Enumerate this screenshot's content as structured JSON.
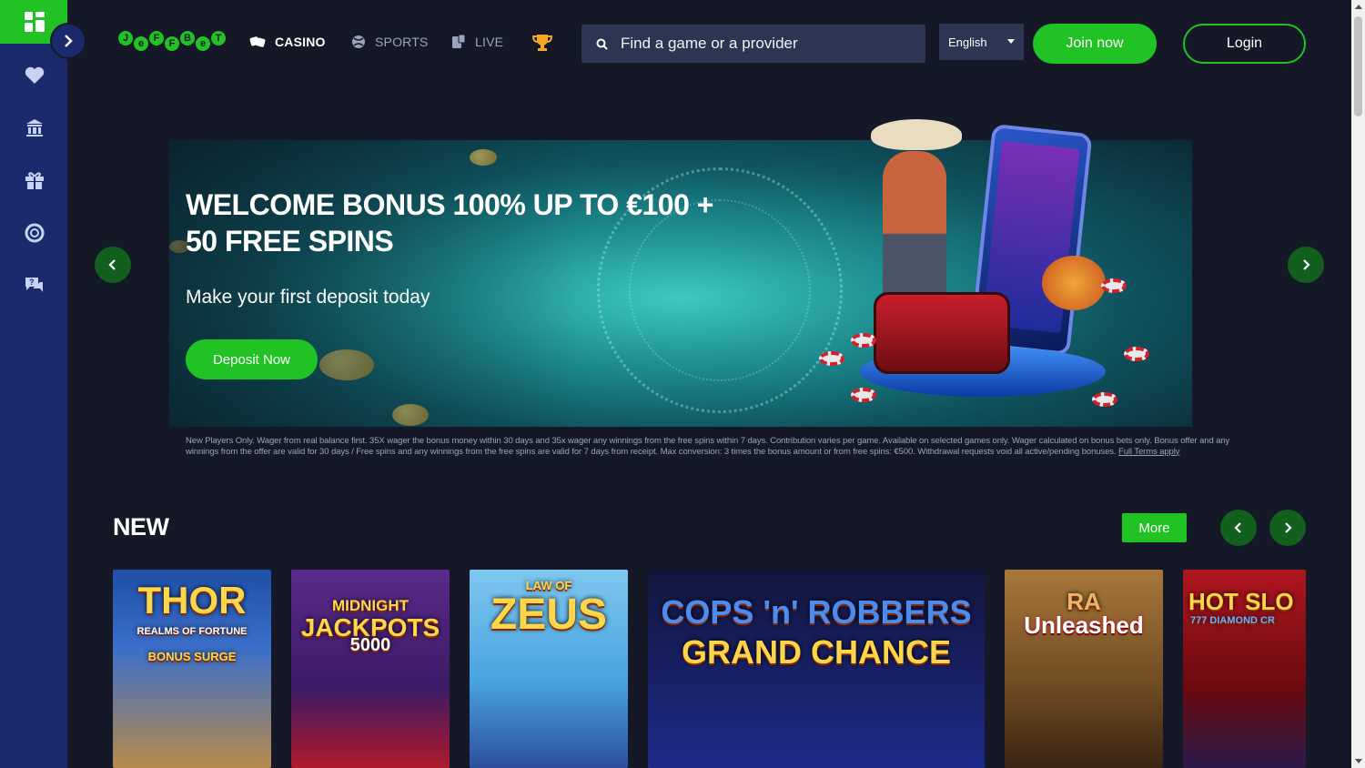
{
  "brand": {
    "logo_letters": [
      "J",
      "e",
      "F",
      "F",
      "B",
      "e",
      "T"
    ]
  },
  "sidebar": {
    "items": [
      {
        "icon": "heart-icon"
      },
      {
        "icon": "casino-building-icon"
      },
      {
        "icon": "gift-icon"
      },
      {
        "icon": "lifebuoy-icon"
      },
      {
        "icon": "help-chat-icon"
      }
    ]
  },
  "nav": {
    "items": [
      {
        "label": "CASINO",
        "icon": "dice-icon",
        "active": true
      },
      {
        "label": "SPORTS",
        "icon": "ball-icon",
        "active": false
      },
      {
        "label": "LIVE",
        "icon": "live-cards-icon",
        "active": false
      }
    ],
    "trophy_icon": "trophy-icon"
  },
  "search": {
    "placeholder": "Find a game or a provider"
  },
  "language": {
    "selected": "English"
  },
  "auth": {
    "join_label": "Join now",
    "login_label": "Login"
  },
  "banner": {
    "title_line1": "WELCOME BONUS 100% UP TO €100 +",
    "title_line2": "50 FREE SPINS",
    "subtitle": "Make your first deposit today",
    "cta_label": "Deposit Now",
    "terms_text": "New Players Only. Wager from real balance first. 35X wager the bonus money within 30 days and 35x wager any winnings from the free spins within 7 days. Contribution varies per game. Available on selected games only. Wager calculated on bonus bets only. Bonus offer and any winnings from the offer are valid for 30 days / Free spins and any winnings from the free spins are valid for 7 days from receipt. Max conversion: 3 times the bonus amount or from free spins: €500. Withdrawal requests void all active/pending bonuses.",
    "terms_link": "Full Terms apply"
  },
  "new_section": {
    "title": "NEW",
    "more_label": "More",
    "games": [
      {
        "name_line1": "THOR",
        "name_line2": "REALMS OF FORTUNE",
        "name_line3": "BONUS SURGE"
      },
      {
        "name_line1": "MIDNIGHT",
        "name_line2": "JACKPOTS",
        "name_line3": "5000"
      },
      {
        "name_line1": "LAW OF",
        "name_line2": "ZEUS",
        "name_line3": ""
      },
      {
        "name_line1": "COPS 'n' ROBBERS",
        "name_line2": "GRAND CHANCE",
        "name_line3": ""
      },
      {
        "name_line1": "RA",
        "name_line2": "Unleashed",
        "name_line3": ""
      },
      {
        "name_line1": "HOT SLO",
        "name_line2": "777 DIAMOND CR",
        "name_line3": ""
      }
    ]
  },
  "colors": {
    "accent_green": "#21c224",
    "sidebar_blue": "#1a2a6c",
    "page_bg": "#151826"
  }
}
